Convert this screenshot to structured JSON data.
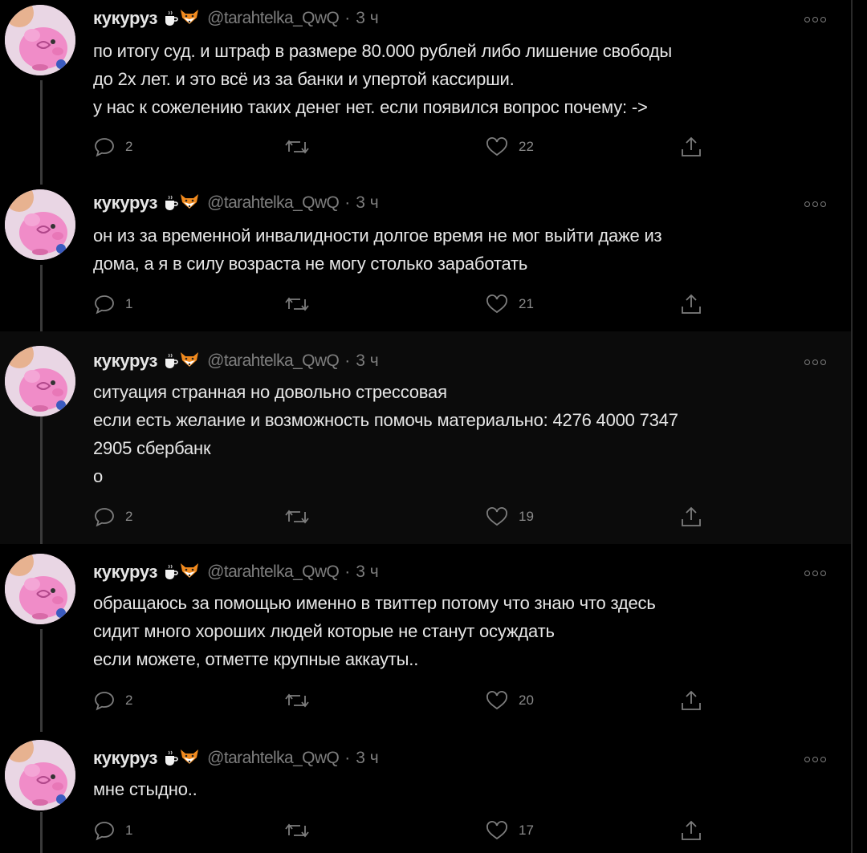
{
  "author": {
    "name": "кукуруз",
    "handle": "@tarahtelka_QwQ",
    "dot": "·",
    "time": "3 ч",
    "badges": [
      "coffee-emoji",
      "fox-emoji"
    ]
  },
  "tweets": [
    {
      "text": "по итогу суд. и штраф в размере 80.000 рублей либо лишение свободы\nдо 2х лет. и это всё из за банки и упертой кассирши.\nу нас к сожелению таких денег нет. если появился вопрос почему: ->",
      "replies": "2",
      "retweets": "",
      "likes": "22"
    },
    {
      "text": "он из за временной инвалидности долгое время не мог выйти даже из\nдома, а я в силу возраста не могу столько заработать",
      "replies": "1",
      "retweets": "",
      "likes": "21"
    },
    {
      "text": "ситуация странная но довольно стрессовая\nесли есть желание и возможность помочь материально: 4276 4000 7347\n2905 сбербанк\nо",
      "replies": "2",
      "retweets": "",
      "likes": "19"
    },
    {
      "text": "обращаюсь за помощью именно в твиттер потому что знаю что здесь\nсидит много хороших людей которые не станут осуждать\nесли можете, отметте крупные аккауты..",
      "replies": "2",
      "retweets": "",
      "likes": "20"
    },
    {
      "text": "мне стыдно..",
      "replies": "1",
      "retweets": "",
      "likes": "17"
    }
  ],
  "colors": {
    "background": "#000000",
    "highlight_background": "#0b0b0b",
    "text": "#e6e6e6",
    "muted": "#7d7d7d",
    "thread_line": "#3a3a3a"
  }
}
